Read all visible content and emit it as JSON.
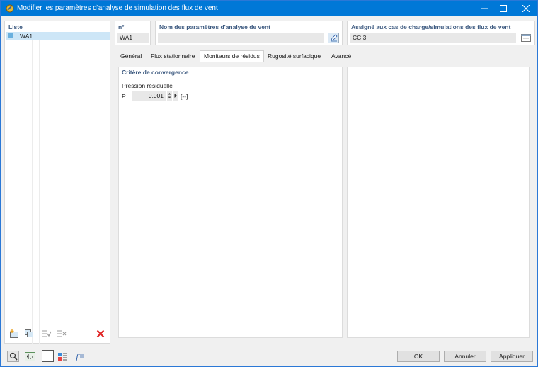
{
  "window": {
    "title": "Modifier les paramètres d'analyse de simulation des flux de vent"
  },
  "list": {
    "label": "Liste",
    "items": [
      {
        "label": "WA1",
        "color": "#6ab0de"
      }
    ]
  },
  "header": {
    "no_label": "n°",
    "no_value": "WA1",
    "name_label": "Nom des paramètres d'analyse de vent",
    "name_value": "",
    "assigned_label": "Assigné aux cas de charge/simulations des flux de vent",
    "assigned_value": "CC 3"
  },
  "tabs": [
    {
      "label": "Général",
      "active": false
    },
    {
      "label": "Flux stationnaire",
      "active": false
    },
    {
      "label": "Moniteurs de résidus",
      "active": true
    },
    {
      "label": "Rugosité surfacique",
      "active": false
    },
    {
      "label": "Avancé",
      "active": false
    }
  ],
  "convergence": {
    "section_label": "Critère de convergence",
    "pressure_label": "Pression résiduelle",
    "p_symbol": "P",
    "p_value": "0.001",
    "p_unit": "[--]"
  },
  "buttons": {
    "ok": "OK",
    "cancel": "Annuler",
    "apply": "Appliquer"
  },
  "colors": {
    "titlebar": "#0078d7",
    "accent_label": "#3d5a80",
    "delete_red": "#e02020"
  }
}
